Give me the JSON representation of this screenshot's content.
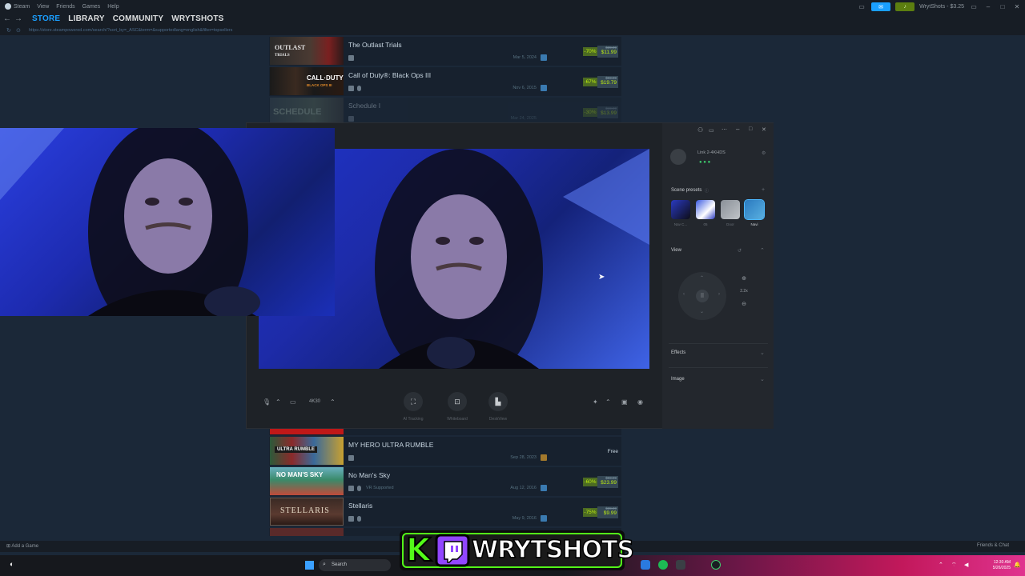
{
  "menubar": {
    "items": [
      "Steam",
      "View",
      "Friends",
      "Games",
      "Help"
    ]
  },
  "topbar": {
    "account": "WrytShots",
    "balance": "$3.25"
  },
  "nav": {
    "tabs": [
      "STORE",
      "LIBRARY",
      "COMMUNITY",
      "WRYTSHOTS"
    ],
    "url": "https://store.steampowered.com/search/?sort_by=_ASC&term=&supportedlang=english&filter=topsellers"
  },
  "games": [
    {
      "title": "The Outlast Trials",
      "date": "Mar 5, 2024",
      "discount": "-70%",
      "original": "$39.99",
      "final": "$11.99"
    },
    {
      "title": "Call of Duty®: Black Ops III",
      "date": "Nov 6, 2015",
      "discount": "-67%",
      "original": "$59.99",
      "final": "$19.79"
    },
    {
      "title": "Schedule I",
      "date": "Mar 24, 2025",
      "discount": "-30%",
      "original": "$19.99",
      "final": "$13.99"
    },
    {
      "title": "MY HERO ULTRA RUMBLE",
      "date": "Sep 28, 2023",
      "price": "Free"
    },
    {
      "title": "No Man's Sky",
      "date": "Aug 12, 2016",
      "extra": "VR Supported",
      "discount": "-60%",
      "original": "$59.99",
      "final": "$23.99"
    },
    {
      "title": "Stellaris",
      "date": "May 9, 2016",
      "discount": "-75%",
      "original": "$39.99",
      "final": "$9.99"
    }
  ],
  "tune": {
    "device": "Link 2-4KHDS",
    "scene_presets_label": "Scene presets",
    "presets": [
      "Nav C...",
      "05",
      "Door",
      "Navi"
    ],
    "view_label": "View",
    "zoom": "2.2x",
    "effects_label": "Effects",
    "image_label": "Image",
    "resolution": "4K30",
    "actions": [
      "AI Tracking",
      "Whiteboard",
      "DeskView"
    ]
  },
  "bottom": {
    "add_game": "Add a Game",
    "friends": "Friends & Chat"
  },
  "taskbar": {
    "search": "Search",
    "time": "12:30 AM",
    "date": "5/26/2025"
  },
  "logo": {
    "text": "WRYTSHOTS",
    "k": "K"
  },
  "colors": {
    "accent": "#1a9fff",
    "discount_bg": "#4c6b22",
    "discount_fg": "#beee11"
  }
}
